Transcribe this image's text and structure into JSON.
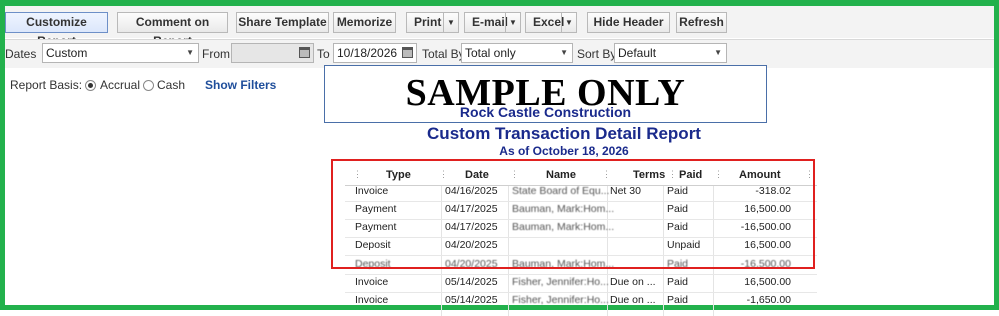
{
  "toolbar": {
    "customize": "Customize Report",
    "comment": "Comment on Report",
    "share": "Share Template",
    "memorize": "Memorize",
    "print": "Print",
    "email": "E-mail",
    "excel": "Excel",
    "hide_header": "Hide Header",
    "refresh": "Refresh"
  },
  "filters": {
    "dates_label": "Dates",
    "dates_value": "Custom",
    "from_label": "From",
    "from_value": "",
    "to_label": "To",
    "to_value": "10/18/2026",
    "total_by_label": "Total By",
    "total_by_value": "Total only",
    "sort_by_label": "Sort By",
    "sort_by_value": "Default"
  },
  "basis": {
    "label": "Report Basis:",
    "accrual": "Accrual",
    "cash": "Cash",
    "selected": "Accrual",
    "show_filters": "Show Filters"
  },
  "report": {
    "watermark": "SAMPLE ONLY",
    "company": "Rock Castle Construction",
    "title": "Custom Transaction Detail Report",
    "as_of": "As of October 18, 2026",
    "columns": [
      "Type",
      "Date",
      "Name",
      "Terms",
      "Paid",
      "Amount"
    ],
    "rows": [
      {
        "type": "Invoice",
        "date": "04/16/2025",
        "name": "State Board of Equ...",
        "terms": "Net 30",
        "paid": "Paid",
        "amount": "-318.02"
      },
      {
        "type": "Payment",
        "date": "04/17/2025",
        "name": "Bauman, Mark:Hom...",
        "terms": "",
        "paid": "Paid",
        "amount": "16,500.00"
      },
      {
        "type": "Payment",
        "date": "04/17/2025",
        "name": "Bauman, Mark:Hom...",
        "terms": "",
        "paid": "Paid",
        "amount": "-16,500.00"
      },
      {
        "type": "Deposit",
        "date": "04/20/2025",
        "name": "",
        "terms": "",
        "paid": "Unpaid",
        "amount": "16,500.00"
      },
      {
        "type": "Deposit",
        "date": "04/20/2025",
        "name": "Bauman, Mark:Hom...",
        "terms": "",
        "paid": "Paid",
        "amount": "-16,500.00"
      },
      {
        "type": "Invoice",
        "date": "05/14/2025",
        "name": "Fisher, Jennifer:Ho...",
        "terms": "Due on ...",
        "paid": "Paid",
        "amount": "16,500.00"
      },
      {
        "type": "Invoice",
        "date": "05/14/2025",
        "name": "Fisher, Jennifer:Ho...",
        "terms": "Due on ...",
        "paid": "Paid",
        "amount": "-1,650.00"
      }
    ]
  },
  "colors": {
    "frame": "#22b14c",
    "report_title": "#1a2a8c",
    "highlight": "#e0201f"
  }
}
